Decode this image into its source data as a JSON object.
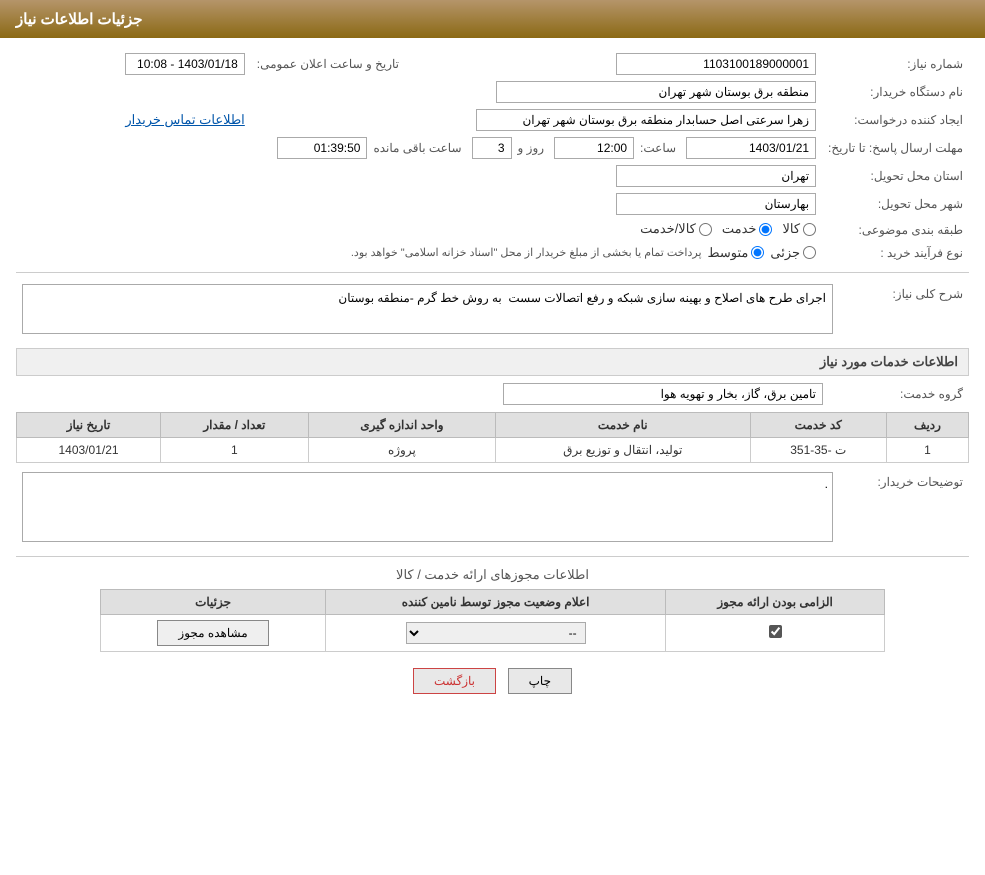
{
  "header": {
    "title": "جزئیات اطلاعات نیاز"
  },
  "fields": {
    "need_number_label": "شماره نیاز:",
    "need_number_value": "1103100189000001",
    "date_label": "تاریخ و ساعت اعلان عمومی:",
    "date_value": "1403/01/18 - 10:08",
    "buyer_org_label": "نام دستگاه خریدار:",
    "buyer_org_value": "منطقه برق بوستان شهر تهران",
    "requester_label": "ایجاد کننده درخواست:",
    "requester_value": "زهرا سرعتی اصل حسابدار منطقه برق بوستان شهر تهران",
    "contact_link": "اطلاعات تماس خریدار",
    "response_deadline_label": "مهلت ارسال پاسخ: تا تاریخ:",
    "deadline_date": "1403/01/21",
    "deadline_time_label": "ساعت:",
    "deadline_time": "12:00",
    "days_label": "روز و",
    "days_value": "3",
    "remaining_label": "ساعت باقی مانده",
    "remaining_time": "01:39:50",
    "province_label": "استان محل تحویل:",
    "province_value": "تهران",
    "city_label": "شهر محل تحویل:",
    "city_value": "بهارستان",
    "category_label": "طبقه بندی موضوعی:",
    "category_options": [
      "کالا",
      "خدمت",
      "کالا/خدمت"
    ],
    "category_selected": "خدمت",
    "process_label": "نوع فرآیند خرید :",
    "process_options": [
      "جزئی",
      "متوسط"
    ],
    "process_note": "پرداخت تمام یا بخشی از مبلغ خریدار از محل \"اسناد خزانه اسلامی\" خواهد بود.",
    "description_label": "شرح کلی نیاز:",
    "description_value": "اجرای طرح های اصلاح و بهینه سازی شبکه و رفع اتصالات سست  به روش خط گرم -منطقه بوستان"
  },
  "services_section": {
    "title": "اطلاعات خدمات مورد نیاز",
    "service_group_label": "گروه خدمت:",
    "service_group_value": "تامین برق، گاز، بخار و تهویه هوا",
    "table": {
      "headers": [
        "ردیف",
        "کد خدمت",
        "نام خدمت",
        "واحد اندازه گیری",
        "تعداد / مقدار",
        "تاریخ نیاز"
      ],
      "rows": [
        {
          "row": "1",
          "code": "ت -35-351",
          "name": "تولید، انتقال و توزیع برق",
          "unit": "پروژه",
          "quantity": "1",
          "date": "1403/01/21"
        }
      ]
    }
  },
  "buyer_desc_label": "توضیحات خریدار:",
  "buyer_desc_value": ".",
  "permissions_section": {
    "title": "اطلاعات مجوزهای ارائه خدمت / کالا",
    "table": {
      "headers": [
        "الزامی بودن ارائه مجوز",
        "اعلام وضعیت مجوز توسط نامین کننده",
        "جزئیات"
      ],
      "rows": [
        {
          "mandatory": true,
          "status": "--",
          "details_btn": "مشاهده مجوز"
        }
      ]
    }
  },
  "buttons": {
    "print": "چاپ",
    "back": "بازگشت"
  }
}
